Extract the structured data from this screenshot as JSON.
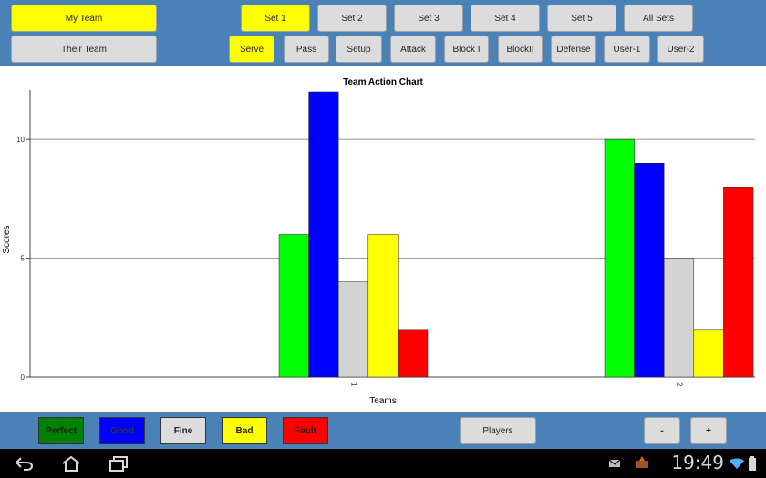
{
  "team_buttons": {
    "my_team": "My Team",
    "their_team": "Their Team"
  },
  "sets": [
    "Set 1",
    "Set 2",
    "Set 3",
    "Set 4",
    "Set 5",
    "All Sets"
  ],
  "active_set": "Set 1",
  "actions": [
    "Serve",
    "Pass",
    "Setup",
    "Attack",
    "Block I",
    "BlockII",
    "Defense",
    "User-1",
    "User-2"
  ],
  "active_action": "Serve",
  "chart_data": {
    "type": "bar",
    "title": "Team Action Chart",
    "xlabel": "Teams",
    "ylabel": "Scores",
    "categories": [
      "1",
      "2"
    ],
    "ylim": [
      0,
      12
    ],
    "yticks": [
      0,
      5,
      10
    ],
    "grid": true,
    "series": [
      {
        "name": "Perfect",
        "color": "#00ff00",
        "values": [
          6,
          10
        ]
      },
      {
        "name": "Good",
        "color": "#0000ff",
        "values": [
          12,
          9
        ]
      },
      {
        "name": "Fine",
        "color": "#d3d3d3",
        "values": [
          4,
          5
        ]
      },
      {
        "name": "Bad",
        "color": "#ffff00",
        "values": [
          6,
          2
        ]
      },
      {
        "name": "Fault",
        "color": "#ff0000",
        "values": [
          2,
          8
        ]
      }
    ]
  },
  "legend": [
    {
      "label": "Perfect",
      "color": "#008000"
    },
    {
      "label": "Good",
      "color": "#0000ff"
    },
    {
      "label": "Fine",
      "color": "#dcdcdc"
    },
    {
      "label": "Bad",
      "color": "#ffff00"
    },
    {
      "label": "Fault",
      "color": "#ff0000"
    }
  ],
  "players_button": "Players",
  "minus_button": "-",
  "plus_button": "+",
  "status": {
    "time": "19:49"
  }
}
